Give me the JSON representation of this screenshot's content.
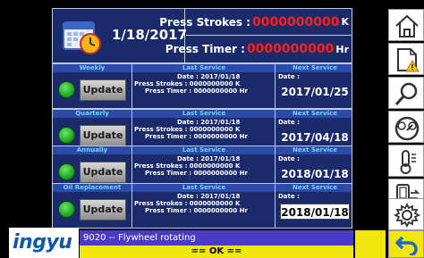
{
  "header": {
    "date": "1/18/2017",
    "press_strokes_label": "Press Strokes :",
    "press_strokes_value": "0000000000",
    "press_strokes_unit": "K",
    "press_timer_label": "Press Timer :",
    "press_timer_value": "0000000000",
    "press_timer_unit": "Hr"
  },
  "table_headers": {
    "last_service": "Last Service",
    "next_service": "Next Service"
  },
  "services": [
    {
      "name": "Weekly",
      "update_label": "Update",
      "last_date": "Date : 2017/01/18",
      "last_strokes": "Press Strokes : 0000000000 K",
      "last_timer": "Press Timer : 0000000000 Hr",
      "next_label": "Date :",
      "next_date": "2017/01/25"
    },
    {
      "name": "Quarterly",
      "update_label": "Update",
      "last_date": "Date : 2017/01/18",
      "last_strokes": "Press Strokes : 0000000000 K",
      "last_timer": "Press Timer : 0000000000 Hr",
      "next_label": "Date :",
      "next_date": "2017/04/18"
    },
    {
      "name": "Annually",
      "update_label": "Update",
      "last_date": "Date : 2017/01/18",
      "last_strokes": "Press Strokes : 0000000000 K",
      "last_timer": "Press Timer : 0000000000 Hr",
      "next_label": "Date :",
      "next_date": "2018/01/18"
    },
    {
      "name": "Oil Replacement",
      "update_label": "Update",
      "last_date": "Date : 2017/01/18",
      "last_strokes": "Press Strokes : 0000000000 K",
      "last_timer": "Press Timer : 0000000000 Hr",
      "next_label": "Date :",
      "next_date": "2018/01/18"
    }
  ],
  "sidebar": {
    "icons": [
      "home-icon",
      "document-warning-icon",
      "magnifier-icon",
      "gauge-icon",
      "thermometer-icon",
      "device-transfer-icon",
      "settings-gear-icon"
    ]
  },
  "footer": {
    "logo": "ingyu",
    "status_message": "9020  -- Flywheel rotating",
    "ok_message": "== OK =="
  },
  "colors": {
    "panel": "#1a2a6a",
    "title_bar": "#2e4aa8",
    "accent_red": "#ff1e1e",
    "status_blue": "#4a3ac8",
    "ok_yellow": "#f1e60d"
  }
}
